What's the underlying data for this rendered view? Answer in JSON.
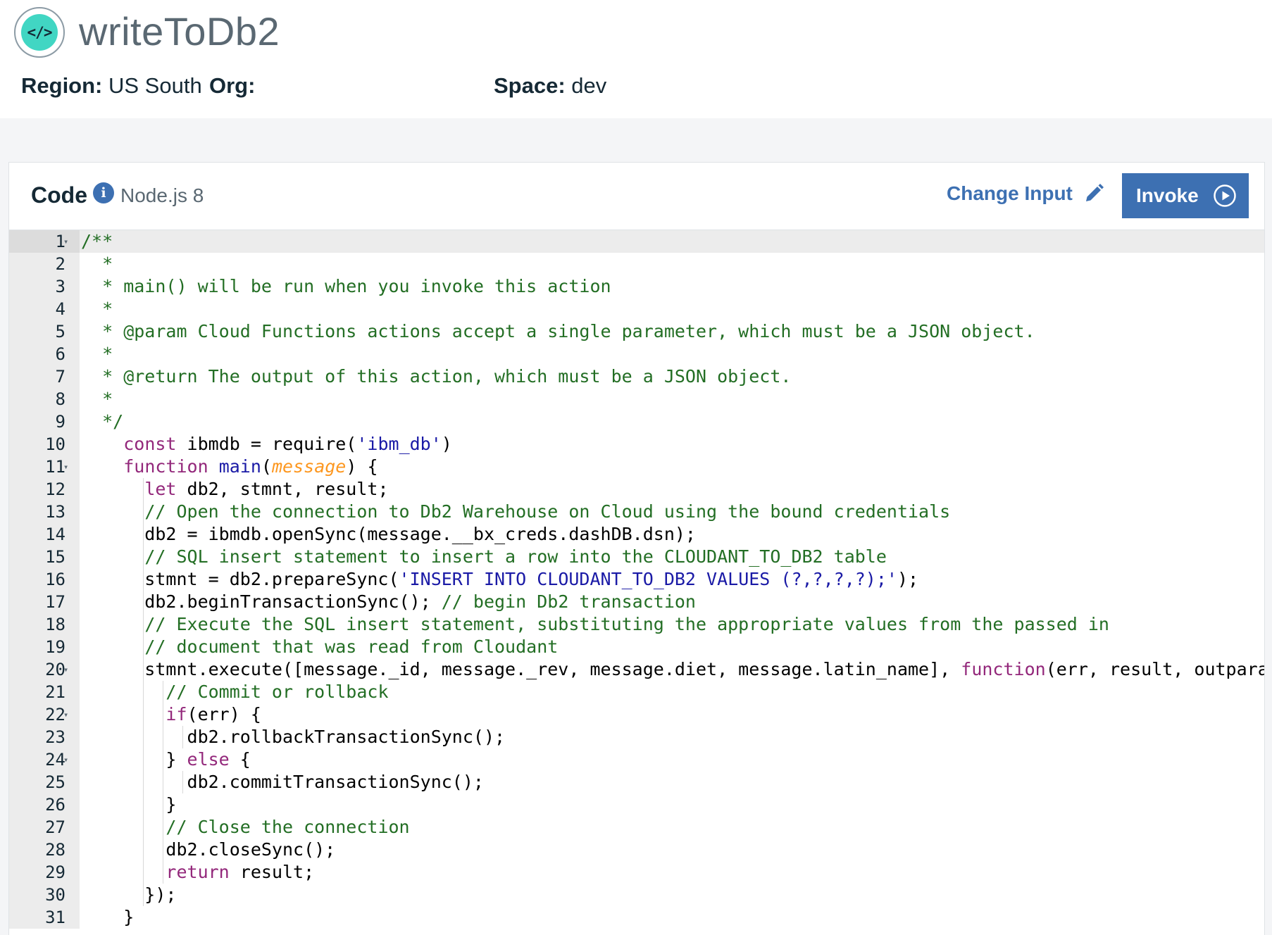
{
  "header": {
    "logo_glyph": "</>",
    "title": "writeToDb2",
    "region_label": "Region:",
    "region_value": "US South",
    "org_label": "Org:",
    "org_value": "",
    "space_label": "Space:",
    "space_value": "dev"
  },
  "code_panel": {
    "title": "Code",
    "info_icon": "i",
    "runtime": "Node.js 8",
    "change_input_label": "Change Input",
    "invoke_label": "Invoke",
    "colors": {
      "accent": "#3d70b2",
      "comment": "#236e24",
      "keyword": "#93287b",
      "string": "#1a1aa6",
      "param": "#fd971f"
    }
  },
  "editor": {
    "lines": [
      {
        "n": "1",
        "fold": true,
        "indent": 0,
        "tokens": [
          [
            "cm",
            "/**"
          ]
        ]
      },
      {
        "n": "2",
        "fold": false,
        "indent": 0,
        "tokens": [
          [
            "cm",
            "  *"
          ]
        ]
      },
      {
        "n": "3",
        "fold": false,
        "indent": 0,
        "tokens": [
          [
            "cm",
            "  * main() will be run when you invoke this action"
          ]
        ]
      },
      {
        "n": "4",
        "fold": false,
        "indent": 0,
        "tokens": [
          [
            "cm",
            "  *"
          ]
        ]
      },
      {
        "n": "5",
        "fold": false,
        "indent": 0,
        "tokens": [
          [
            "cm",
            "  * @param Cloud Functions actions accept a single parameter, which must be a JSON object."
          ]
        ]
      },
      {
        "n": "6",
        "fold": false,
        "indent": 0,
        "tokens": [
          [
            "cm",
            "  *"
          ]
        ]
      },
      {
        "n": "7",
        "fold": false,
        "indent": 0,
        "tokens": [
          [
            "cm",
            "  * @return The output of this action, which must be a JSON object."
          ]
        ]
      },
      {
        "n": "8",
        "fold": false,
        "indent": 0,
        "tokens": [
          [
            "cm",
            "  *"
          ]
        ]
      },
      {
        "n": "9",
        "fold": false,
        "indent": 0,
        "tokens": [
          [
            "cm",
            "  */"
          ]
        ]
      },
      {
        "n": "10",
        "fold": false,
        "indent": 0,
        "tokens": [
          [
            "pl",
            "    "
          ],
          [
            "kw",
            "const"
          ],
          [
            "pl",
            " ibmdb = require("
          ],
          [
            "str",
            "'ibm_db'"
          ],
          [
            "pl",
            ")"
          ]
        ]
      },
      {
        "n": "11",
        "fold": true,
        "indent": 0,
        "tokens": [
          [
            "pl",
            "    "
          ],
          [
            "kw",
            "function"
          ],
          [
            "pl",
            " "
          ],
          [
            "fn",
            "main"
          ],
          [
            "pl",
            "("
          ],
          [
            "par",
            "message"
          ],
          [
            "pl",
            ") {"
          ]
        ]
      },
      {
        "n": "12",
        "fold": false,
        "indent": 1,
        "tokens": [
          [
            "pl",
            "      "
          ],
          [
            "kw",
            "let"
          ],
          [
            "pl",
            " db2, stmnt, result;"
          ]
        ]
      },
      {
        "n": "13",
        "fold": false,
        "indent": 1,
        "tokens": [
          [
            "pl",
            "      "
          ],
          [
            "cm",
            "// Open the connection to Db2 Warehouse on Cloud using the bound credentials"
          ]
        ]
      },
      {
        "n": "14",
        "fold": false,
        "indent": 1,
        "tokens": [
          [
            "pl",
            "      db2 = ibmdb.openSync(message.__bx_creds.dashDB.dsn);"
          ]
        ]
      },
      {
        "n": "15",
        "fold": false,
        "indent": 1,
        "tokens": [
          [
            "pl",
            "      "
          ],
          [
            "cm",
            "// SQL insert statement to insert a row into the CLOUDANT_TO_DB2 table"
          ]
        ]
      },
      {
        "n": "16",
        "fold": false,
        "indent": 1,
        "tokens": [
          [
            "pl",
            "      stmnt = db2.prepareSync("
          ],
          [
            "str",
            "'INSERT INTO CLOUDANT_TO_DB2 VALUES (?,?,?,?);'"
          ],
          [
            "pl",
            ");"
          ]
        ]
      },
      {
        "n": "17",
        "fold": false,
        "indent": 1,
        "tokens": [
          [
            "pl",
            "      db2.beginTransactionSync(); "
          ],
          [
            "cm",
            "// begin Db2 transaction"
          ]
        ]
      },
      {
        "n": "18",
        "fold": false,
        "indent": 1,
        "tokens": [
          [
            "pl",
            "      "
          ],
          [
            "cm",
            "// Execute the SQL insert statement, substituting the appropriate values from the passed in"
          ]
        ]
      },
      {
        "n": "19",
        "fold": false,
        "indent": 1,
        "tokens": [
          [
            "pl",
            "      "
          ],
          [
            "cm",
            "// document that was read from Cloudant"
          ]
        ]
      },
      {
        "n": "20",
        "fold": true,
        "indent": 1,
        "tokens": [
          [
            "pl",
            "      stmnt.execute([message._id, message._rev, message.diet, message.latin_name], "
          ],
          [
            "kw",
            "function"
          ],
          [
            "pl",
            "(err, result, outparams){"
          ]
        ]
      },
      {
        "n": "21",
        "fold": false,
        "indent": 2,
        "tokens": [
          [
            "pl",
            "        "
          ],
          [
            "cm",
            "// Commit or rollback"
          ]
        ]
      },
      {
        "n": "22",
        "fold": true,
        "indent": 2,
        "tokens": [
          [
            "pl",
            "        "
          ],
          [
            "kw",
            "if"
          ],
          [
            "pl",
            "(err) {"
          ]
        ]
      },
      {
        "n": "23",
        "fold": false,
        "indent": 3,
        "tokens": [
          [
            "pl",
            "          db2.rollbackTransactionSync();"
          ]
        ]
      },
      {
        "n": "24",
        "fold": true,
        "indent": 2,
        "tokens": [
          [
            "pl",
            "        } "
          ],
          [
            "kw",
            "else"
          ],
          [
            "pl",
            " {"
          ]
        ]
      },
      {
        "n": "25",
        "fold": false,
        "indent": 3,
        "tokens": [
          [
            "pl",
            "          db2.commitTransactionSync();"
          ]
        ]
      },
      {
        "n": "26",
        "fold": false,
        "indent": 2,
        "tokens": [
          [
            "pl",
            "        }"
          ]
        ]
      },
      {
        "n": "27",
        "fold": false,
        "indent": 2,
        "tokens": [
          [
            "pl",
            "        "
          ],
          [
            "cm",
            "// Close the connection"
          ]
        ]
      },
      {
        "n": "28",
        "fold": false,
        "indent": 2,
        "tokens": [
          [
            "pl",
            "        db2.closeSync();"
          ]
        ]
      },
      {
        "n": "29",
        "fold": false,
        "indent": 2,
        "tokens": [
          [
            "pl",
            "        "
          ],
          [
            "kw",
            "return"
          ],
          [
            "pl",
            " result;"
          ]
        ]
      },
      {
        "n": "30",
        "fold": false,
        "indent": 1,
        "tokens": [
          [
            "pl",
            "      });"
          ]
        ]
      },
      {
        "n": "31",
        "fold": false,
        "indent": 0,
        "tokens": [
          [
            "pl",
            "    }"
          ]
        ]
      }
    ]
  }
}
